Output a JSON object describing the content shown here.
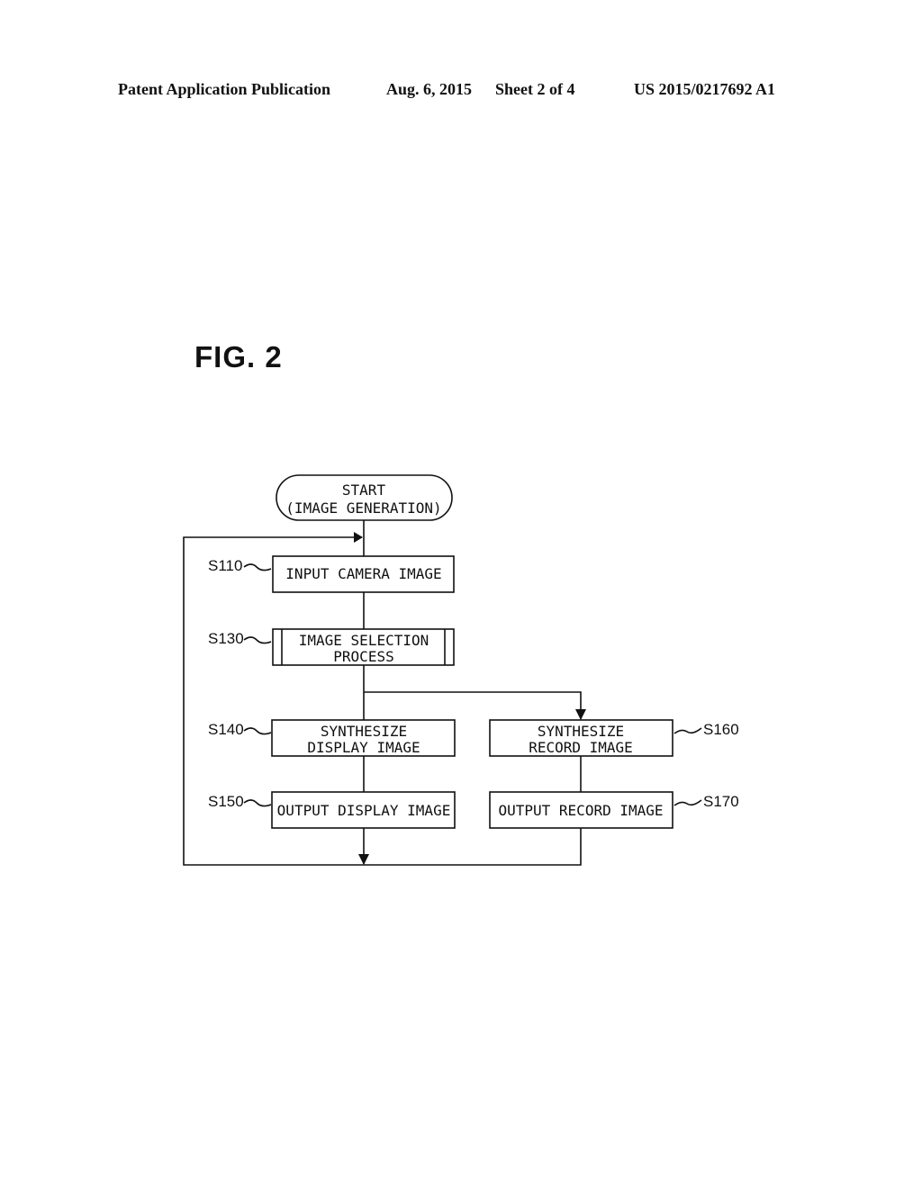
{
  "header": {
    "publication": "Patent Application Publication",
    "date": "Aug. 6, 2015",
    "sheet": "Sheet 2 of 4",
    "number": "US 2015/0217692 A1"
  },
  "figure_label": "FIG. 2",
  "flowchart": {
    "start": {
      "line1": "START",
      "line2": "(IMAGE GENERATION)"
    },
    "steps": {
      "s110": {
        "id": "S110",
        "line1": "INPUT CAMERA IMAGE"
      },
      "s130": {
        "id": "S130",
        "line1": "IMAGE SELECTION",
        "line2": "PROCESS"
      },
      "s140": {
        "id": "S140",
        "line1": "SYNTHESIZE",
        "line2": "DISPLAY IMAGE"
      },
      "s150": {
        "id": "S150",
        "line1": "OUTPUT DISPLAY IMAGE"
      },
      "s160": {
        "id": "S160",
        "line1": "SYNTHESIZE",
        "line2": "RECORD IMAGE"
      },
      "s170": {
        "id": "S170",
        "line1": "OUTPUT RECORD IMAGE"
      }
    }
  }
}
